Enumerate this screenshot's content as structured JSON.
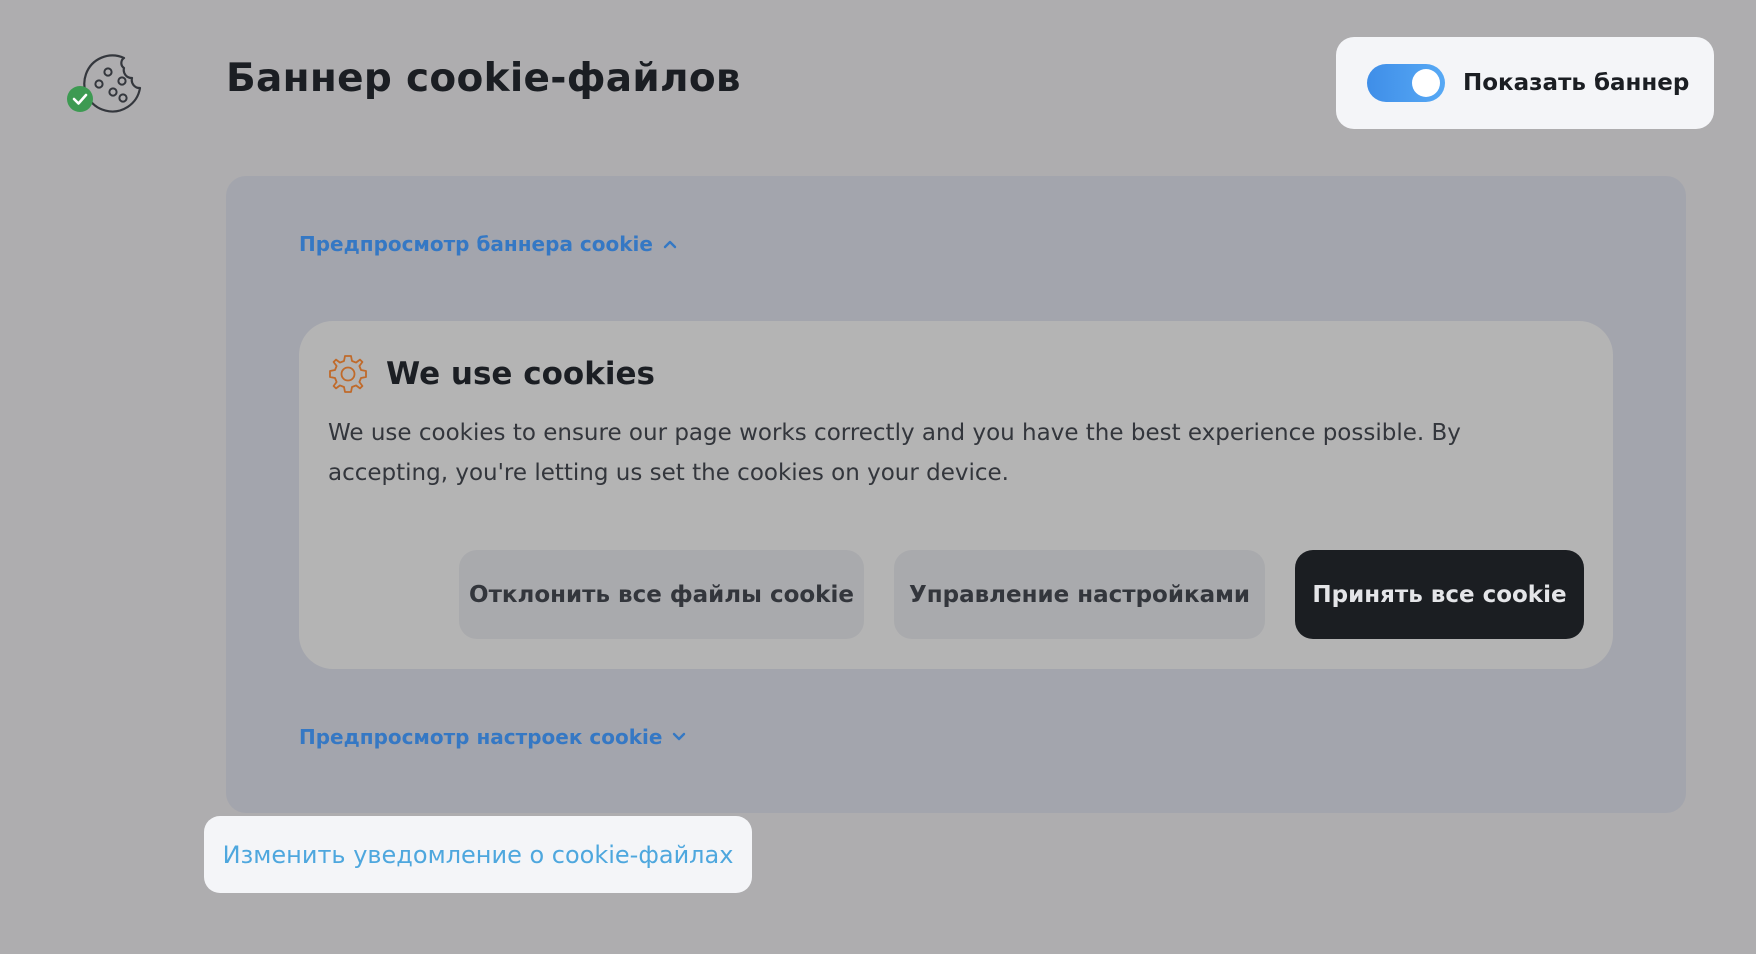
{
  "header": {
    "logo_icon": "cookie-check-icon",
    "title": "Баннер cookie-файлов"
  },
  "toggle": {
    "label": "Показать баннер",
    "on": true,
    "color": "#4a9ef0"
  },
  "preview": {
    "banner_section_label": "Предпросмотр баннера cookie",
    "banner_section_icon": "chevron-up-icon",
    "settings_section_label": "Предпросмотр настроек cookie",
    "settings_section_icon": "chevron-down-icon",
    "accent_color": "#3578c4"
  },
  "banner": {
    "icon": "gear-icon",
    "icon_color": "#c06a2a",
    "title": "We use cookies",
    "text": "We use cookies to ensure our page works correctly and you have the best experience possible. By accepting, you're letting us set the cookies on your device.",
    "buttons": {
      "reject": "Отклонить все файлы cookie",
      "manage": "Управление настройками",
      "accept": "Принять все cookie"
    }
  },
  "edit_link": {
    "label": "Изменить уведомление о cookie-файлах",
    "color": "#4ea7de"
  }
}
